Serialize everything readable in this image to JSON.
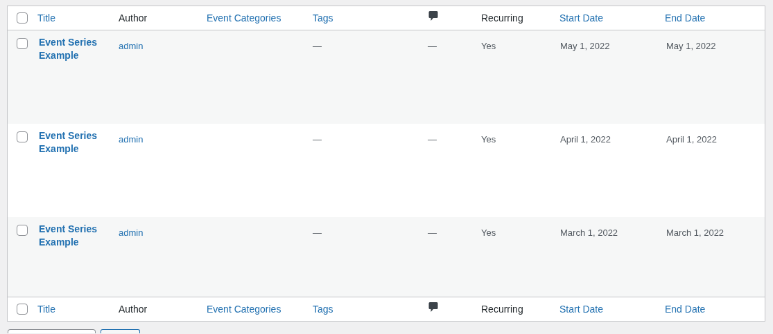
{
  "table": {
    "columns": [
      {
        "kind": "sortable",
        "label": "Title"
      },
      {
        "kind": "plain",
        "label": "Author"
      },
      {
        "kind": "sortable",
        "label": "Event Categories"
      },
      {
        "kind": "sortable",
        "label": "Tags"
      },
      {
        "kind": "comments"
      },
      {
        "kind": "plain",
        "label": "Recurring"
      },
      {
        "kind": "sortable",
        "label": "Start Date"
      },
      {
        "kind": "sortable",
        "label": "End Date"
      }
    ],
    "select_all_checked": false,
    "footer_columns": [
      {
        "kind": "sortable",
        "label": "Title"
      },
      {
        "kind": "plain",
        "label": "Author"
      },
      {
        "kind": "sortable",
        "label": "Event Categories"
      },
      {
        "kind": "sortable",
        "label": "Tags"
      },
      {
        "kind": "comments"
      },
      {
        "kind": "plain",
        "label": "Recurring"
      },
      {
        "kind": "sortable",
        "label": "Start Date"
      },
      {
        "kind": "sortable",
        "label": "End Date"
      }
    ],
    "footer_select_all_checked": false,
    "rows": [
      {
        "checked": false,
        "title": "Event Series Example",
        "author": "admin",
        "tags": "—",
        "comments": "—",
        "recurring": "Yes",
        "start_date": "May 1, 2022",
        "end_date": "May 1, 2022"
      },
      {
        "checked": false,
        "title": "Event Series Example",
        "author": "admin",
        "tags": "—",
        "comments": "—",
        "recurring": "Yes",
        "start_date": "April 1, 2022",
        "end_date": "April 1, 2022"
      },
      {
        "checked": false,
        "title": "Event Series Example",
        "author": "admin",
        "tags": "—",
        "comments": "—",
        "recurring": "Yes",
        "start_date": "March 1, 2022",
        "end_date": "March 1, 2022"
      }
    ]
  }
}
